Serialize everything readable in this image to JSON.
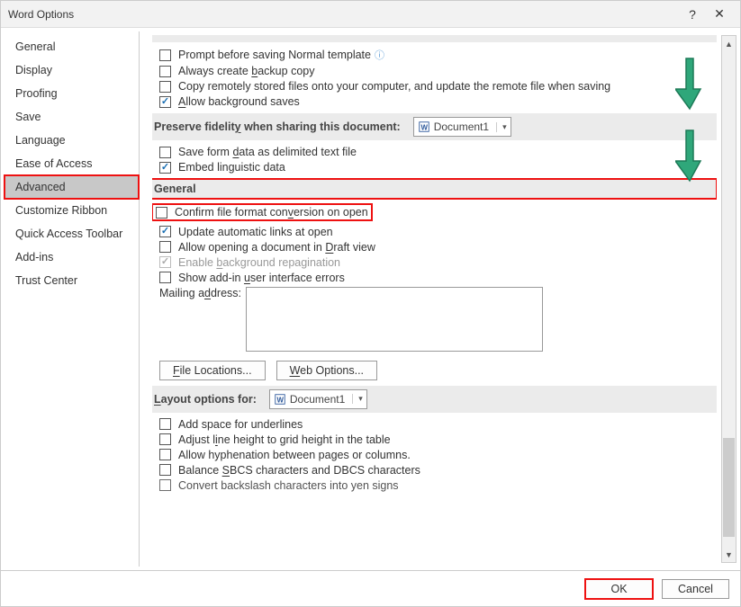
{
  "title": "Word Options",
  "sidebar": {
    "items": [
      {
        "label": "General"
      },
      {
        "label": "Display"
      },
      {
        "label": "Proofing"
      },
      {
        "label": "Save"
      },
      {
        "label": "Language"
      },
      {
        "label": "Ease of Access"
      },
      {
        "label": "Advanced"
      },
      {
        "label": "Customize Ribbon"
      },
      {
        "label": "Quick Access Toolbar"
      },
      {
        "label": "Add-ins"
      },
      {
        "label": "Trust Center"
      }
    ]
  },
  "save_section": {
    "opt_prompt_normal": "Prompt before saving Normal template",
    "opt_backup_pre": "Always create ",
    "opt_backup_und": "b",
    "opt_backup_post": "ackup copy",
    "opt_remote": "Copy remotely stored files onto your computer, and update the remote file when saving",
    "opt_bgsave_und": "A",
    "opt_bgsave_post": "llow background saves"
  },
  "preserve_section": {
    "header_pre": "Preserve fidelit",
    "header_und": "y",
    "header_post": " when sharing this document:",
    "doc_name": "Document1",
    "opt_formdata_pre": "Save form ",
    "opt_formdata_und": "d",
    "opt_formdata_post": "ata as delimited text file",
    "opt_embed": "Embed linguistic data"
  },
  "general_section": {
    "header": "General",
    "opt_confirm_pre": "Confirm file format con",
    "opt_confirm_und": "v",
    "opt_confirm_post": "ersion on open",
    "opt_update": "Update automatic links at open",
    "opt_draft_pre": "Allow opening a document in ",
    "opt_draft_und": "D",
    "opt_draft_post": "raft view",
    "opt_repag_pre": "Enable ",
    "opt_repag_und": "b",
    "opt_repag_post": "ackground repagination",
    "opt_addin_pre": "Show add-in ",
    "opt_addin_und": "u",
    "opt_addin_post": "ser interface errors",
    "mailing_label_pre": "Mailing a",
    "mailing_label_und": "d",
    "mailing_label_post": "dress:",
    "btn_file_loc_und": "F",
    "btn_file_loc_post": "ile Locations...",
    "btn_web_und": "W",
    "btn_web_post": "eb Options..."
  },
  "layout_section": {
    "header_und": "L",
    "header_post": "ayout options for:",
    "doc_name": "Document1",
    "opt_underlines": "Add space for underlines",
    "opt_grid_pre": "Adjust l",
    "opt_grid_und": "i",
    "opt_grid_post": "ne height to grid height in the table",
    "opt_hyphen": "Allow hyphenation between pages or columns.",
    "opt_sbcs_pre": "Balance ",
    "opt_sbcs_und": "S",
    "opt_sbcs_post": "BCS characters and DBCS characters",
    "opt_yen": "Convert backslash characters into yen signs"
  },
  "footer": {
    "ok": "OK",
    "cancel": "Cancel"
  }
}
